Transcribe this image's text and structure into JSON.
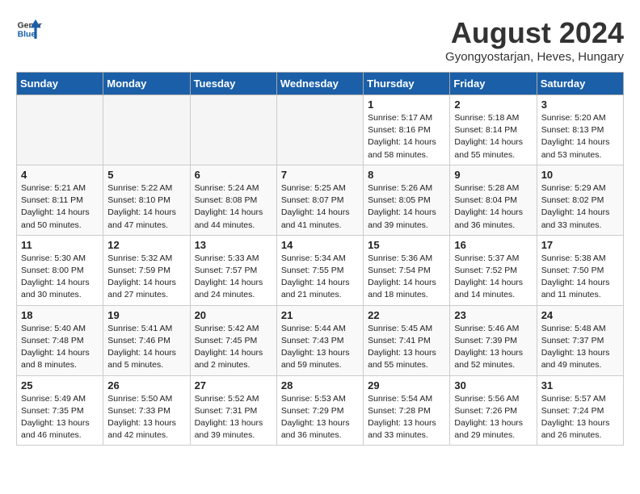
{
  "header": {
    "logo_text_general": "General",
    "logo_text_blue": "Blue",
    "month_title": "August 2024",
    "location": "Gyongyostarjan, Heves, Hungary"
  },
  "weekdays": [
    "Sunday",
    "Monday",
    "Tuesday",
    "Wednesday",
    "Thursday",
    "Friday",
    "Saturday"
  ],
  "weeks": [
    [
      {
        "day": "",
        "info": ""
      },
      {
        "day": "",
        "info": ""
      },
      {
        "day": "",
        "info": ""
      },
      {
        "day": "",
        "info": ""
      },
      {
        "day": "1",
        "info": "Sunrise: 5:17 AM\nSunset: 8:16 PM\nDaylight: 14 hours\nand 58 minutes."
      },
      {
        "day": "2",
        "info": "Sunrise: 5:18 AM\nSunset: 8:14 PM\nDaylight: 14 hours\nand 55 minutes."
      },
      {
        "day": "3",
        "info": "Sunrise: 5:20 AM\nSunset: 8:13 PM\nDaylight: 14 hours\nand 53 minutes."
      }
    ],
    [
      {
        "day": "4",
        "info": "Sunrise: 5:21 AM\nSunset: 8:11 PM\nDaylight: 14 hours\nand 50 minutes."
      },
      {
        "day": "5",
        "info": "Sunrise: 5:22 AM\nSunset: 8:10 PM\nDaylight: 14 hours\nand 47 minutes."
      },
      {
        "day": "6",
        "info": "Sunrise: 5:24 AM\nSunset: 8:08 PM\nDaylight: 14 hours\nand 44 minutes."
      },
      {
        "day": "7",
        "info": "Sunrise: 5:25 AM\nSunset: 8:07 PM\nDaylight: 14 hours\nand 41 minutes."
      },
      {
        "day": "8",
        "info": "Sunrise: 5:26 AM\nSunset: 8:05 PM\nDaylight: 14 hours\nand 39 minutes."
      },
      {
        "day": "9",
        "info": "Sunrise: 5:28 AM\nSunset: 8:04 PM\nDaylight: 14 hours\nand 36 minutes."
      },
      {
        "day": "10",
        "info": "Sunrise: 5:29 AM\nSunset: 8:02 PM\nDaylight: 14 hours\nand 33 minutes."
      }
    ],
    [
      {
        "day": "11",
        "info": "Sunrise: 5:30 AM\nSunset: 8:00 PM\nDaylight: 14 hours\nand 30 minutes."
      },
      {
        "day": "12",
        "info": "Sunrise: 5:32 AM\nSunset: 7:59 PM\nDaylight: 14 hours\nand 27 minutes."
      },
      {
        "day": "13",
        "info": "Sunrise: 5:33 AM\nSunset: 7:57 PM\nDaylight: 14 hours\nand 24 minutes."
      },
      {
        "day": "14",
        "info": "Sunrise: 5:34 AM\nSunset: 7:55 PM\nDaylight: 14 hours\nand 21 minutes."
      },
      {
        "day": "15",
        "info": "Sunrise: 5:36 AM\nSunset: 7:54 PM\nDaylight: 14 hours\nand 18 minutes."
      },
      {
        "day": "16",
        "info": "Sunrise: 5:37 AM\nSunset: 7:52 PM\nDaylight: 14 hours\nand 14 minutes."
      },
      {
        "day": "17",
        "info": "Sunrise: 5:38 AM\nSunset: 7:50 PM\nDaylight: 14 hours\nand 11 minutes."
      }
    ],
    [
      {
        "day": "18",
        "info": "Sunrise: 5:40 AM\nSunset: 7:48 PM\nDaylight: 14 hours\nand 8 minutes."
      },
      {
        "day": "19",
        "info": "Sunrise: 5:41 AM\nSunset: 7:46 PM\nDaylight: 14 hours\nand 5 minutes."
      },
      {
        "day": "20",
        "info": "Sunrise: 5:42 AM\nSunset: 7:45 PM\nDaylight: 14 hours\nand 2 minutes."
      },
      {
        "day": "21",
        "info": "Sunrise: 5:44 AM\nSunset: 7:43 PM\nDaylight: 13 hours\nand 59 minutes."
      },
      {
        "day": "22",
        "info": "Sunrise: 5:45 AM\nSunset: 7:41 PM\nDaylight: 13 hours\nand 55 minutes."
      },
      {
        "day": "23",
        "info": "Sunrise: 5:46 AM\nSunset: 7:39 PM\nDaylight: 13 hours\nand 52 minutes."
      },
      {
        "day": "24",
        "info": "Sunrise: 5:48 AM\nSunset: 7:37 PM\nDaylight: 13 hours\nand 49 minutes."
      }
    ],
    [
      {
        "day": "25",
        "info": "Sunrise: 5:49 AM\nSunset: 7:35 PM\nDaylight: 13 hours\nand 46 minutes."
      },
      {
        "day": "26",
        "info": "Sunrise: 5:50 AM\nSunset: 7:33 PM\nDaylight: 13 hours\nand 42 minutes."
      },
      {
        "day": "27",
        "info": "Sunrise: 5:52 AM\nSunset: 7:31 PM\nDaylight: 13 hours\nand 39 minutes."
      },
      {
        "day": "28",
        "info": "Sunrise: 5:53 AM\nSunset: 7:29 PM\nDaylight: 13 hours\nand 36 minutes."
      },
      {
        "day": "29",
        "info": "Sunrise: 5:54 AM\nSunset: 7:28 PM\nDaylight: 13 hours\nand 33 minutes."
      },
      {
        "day": "30",
        "info": "Sunrise: 5:56 AM\nSunset: 7:26 PM\nDaylight: 13 hours\nand 29 minutes."
      },
      {
        "day": "31",
        "info": "Sunrise: 5:57 AM\nSunset: 7:24 PM\nDaylight: 13 hours\nand 26 minutes."
      }
    ]
  ]
}
